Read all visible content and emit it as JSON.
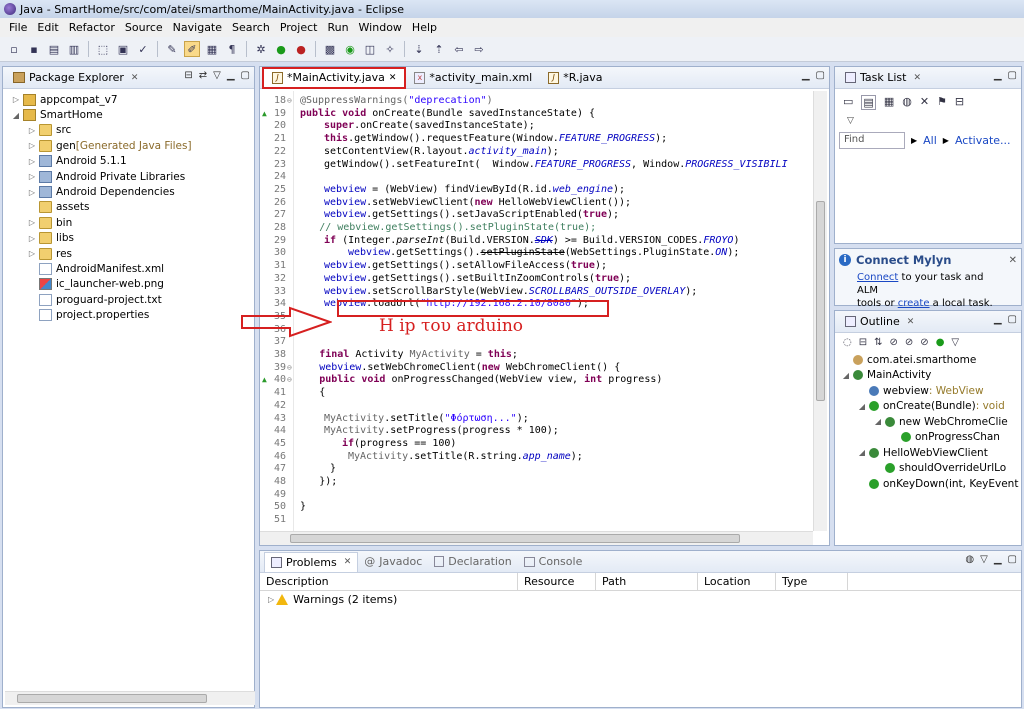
{
  "window": {
    "title": "Java - SmartHome/src/com/atei/smarthome/MainActivity.java - Eclipse"
  },
  "menu": [
    "File",
    "Edit",
    "Refactor",
    "Source",
    "Navigate",
    "Search",
    "Project",
    "Run",
    "Window",
    "Help"
  ],
  "package_explorer": {
    "title": "Package Explorer",
    "items": [
      {
        "label": "appcompat_v7",
        "twisty": "▷",
        "indent": 0,
        "icon": "project-icon"
      },
      {
        "label": "SmartHome",
        "twisty": "◢",
        "indent": 0,
        "icon": "project-icon"
      },
      {
        "label": "src",
        "twisty": "▷",
        "indent": 1,
        "icon": "folder-icon"
      },
      {
        "label": "gen",
        "extra": "[Generated Java Files]",
        "twisty": "▷",
        "indent": 1,
        "icon": "folder-icon"
      },
      {
        "label": "Android 5.1.1",
        "twisty": "▷",
        "indent": 1,
        "icon": "library-icon"
      },
      {
        "label": "Android Private Libraries",
        "twisty": "▷",
        "indent": 1,
        "icon": "library-icon"
      },
      {
        "label": "Android Dependencies",
        "twisty": "▷",
        "indent": 1,
        "icon": "library-icon"
      },
      {
        "label": "assets",
        "twisty": "",
        "indent": 1,
        "icon": "folder-icon"
      },
      {
        "label": "bin",
        "twisty": "▷",
        "indent": 1,
        "icon": "folder-icon"
      },
      {
        "label": "libs",
        "twisty": "▷",
        "indent": 1,
        "icon": "folder-icon"
      },
      {
        "label": "res",
        "twisty": "▷",
        "indent": 1,
        "icon": "folder-icon"
      },
      {
        "label": "AndroidManifest.xml",
        "twisty": "",
        "indent": 1,
        "icon": "file-icon"
      },
      {
        "label": "ic_launcher-web.png",
        "twisty": "",
        "indent": 1,
        "icon": "image-icon"
      },
      {
        "label": "proguard-project.txt",
        "twisty": "",
        "indent": 1,
        "icon": "file-icon"
      },
      {
        "label": "project.properties",
        "twisty": "",
        "indent": 1,
        "icon": "file-icon"
      }
    ]
  },
  "editor": {
    "tabs": [
      {
        "label": "*MainActivity.java",
        "active": true,
        "icon": "java-icon"
      },
      {
        "label": "*activity_main.xml",
        "active": false,
        "icon": "xml-icon"
      },
      {
        "label": "*R.java",
        "active": false,
        "icon": "java-icon"
      }
    ],
    "lines": [
      {
        "n": "18",
        "fold": "⊖",
        "html": "<span class='ann'>@SuppressWarnings(</span><span class='str'>\"deprecation\"</span><span class='ann'>)</span>",
        "indent": 0
      },
      {
        "n": "19",
        "marker": "▲",
        "html": "<span class='kw'>public void</span> onCreate(Bundle savedInstanceState) {",
        "indent": 0
      },
      {
        "n": "20",
        "html": "<span class='kw'>super</span>.onCreate(savedInstanceState);",
        "indent": 2
      },
      {
        "n": "21",
        "html": "<span class='kw'>this</span>.getWindow().requestFeature(Window.<span class='sfld'>FEATURE_PROGRESS</span>);",
        "indent": 2
      },
      {
        "n": "22",
        "html": "setContentView(R.layout.<span class='sfld'>activity_main</span>);",
        "indent": 2
      },
      {
        "n": "23",
        "html": "getWindow().setFeatureInt(  Window.<span class='sfld'>FEATURE_PROGRESS</span>, Window.<span class='sfld'>PROGRESS_VISIBILI</span>",
        "indent": 2
      },
      {
        "n": "24",
        "html": "",
        "indent": 0
      },
      {
        "n": "25",
        "html": "<span class='fld'>webview</span> = (WebView) findViewById(R.id.<span class='sfld'>web_engine</span>);",
        "indent": 2
      },
      {
        "n": "26",
        "html": "<span class='fld'>webview</span>.setWebViewClient(<span class='kw'>new</span> HelloWebViewClient());",
        "indent": 2
      },
      {
        "n": "27",
        "html": "<span class='fld'>webview</span>.getSettings().setJavaScriptEnabled(<span class='kw'>true</span>);",
        "indent": 2
      },
      {
        "n": "28",
        "html": "<span class='cmt'>// webview.getSettings().setPluginState(true);</span>",
        "indent": 1.6
      },
      {
        "n": "29",
        "html": "<span class='kw'>if</span> (Integer.<span class='smeth'>parseInt</span>(Build.VERSION.<span class='sfld strike'>SDK</span>) &gt;= Build.VERSION_CODES.<span class='sfld'>FROYO</span>)",
        "indent": 2
      },
      {
        "n": "30",
        "html": "<span class='fld'>webview</span>.getSettings().<span class='strike'>setPluginState</span>(WebSettings.PluginState.<span class='sfld'>ON</span>);",
        "indent": 4
      },
      {
        "n": "31",
        "html": "<span class='fld'>webview</span>.getSettings().setAllowFileAccess(<span class='kw'>true</span>);",
        "indent": 2
      },
      {
        "n": "32",
        "html": "<span class='fld'>webview</span>.getSettings().setBuiltInZoomControls(<span class='kw'>true</span>);",
        "indent": 2
      },
      {
        "n": "33",
        "html": "<span class='fld'>webview</span>.setScrollBarStyle(WebView.<span class='sfld'>SCROLLBARS_OUTSIDE_OVERLAY</span>);",
        "indent": 2
      },
      {
        "n": "34",
        "html": "<span class='fld'>webview</span>.loadUrl(<span class='str'>\"http://192.168.2.10/8080\"</span>);",
        "indent": 2
      },
      {
        "n": "35",
        "html": "",
        "indent": 0
      },
      {
        "n": "36",
        "html": "",
        "indent": 0
      },
      {
        "n": "37",
        "html": "",
        "indent": 0
      },
      {
        "n": "38",
        "html": "<span class='kw'>final</span> Activity <span class='ann'>MyActivity</span> = <span class='kw'>this</span>;",
        "indent": 1.6
      },
      {
        "n": "39",
        "fold": "⊖",
        "html": "<span class='fld'>webview</span>.setWebChromeClient(<span class='kw'>new</span> WebChromeClient() {",
        "indent": 1.6
      },
      {
        "n": "40",
        "marker": "▲",
        "fold": "⊖",
        "html": "<span class='kw'>public void</span> onProgressChanged(WebView view, <span class='kw'>int</span> progress)",
        "indent": 1.6
      },
      {
        "n": "41",
        "html": "{",
        "indent": 1.6
      },
      {
        "n": "42",
        "html": "",
        "indent": 0
      },
      {
        "n": "43",
        "html": "<span class='ann'>MyActivity</span>.setTitle(<span class='str'>\"Φόρτωση...\"</span>);",
        "indent": 2
      },
      {
        "n": "44",
        "html": "<span class='ann'>MyActivity</span>.setProgress(progress * 100);",
        "indent": 2
      },
      {
        "n": "45",
        "html": "<span class='kw'>if</span>(progress == 100)",
        "indent": 3.5
      },
      {
        "n": "46",
        "html": "<span class='ann'>MyActivity</span>.setTitle(R.string.<span class='sfld'>app_name</span>);",
        "indent": 4
      },
      {
        "n": "47",
        "html": "}",
        "indent": 2.5
      },
      {
        "n": "48",
        "html": "});",
        "indent": 1.6
      },
      {
        "n": "49",
        "html": "",
        "indent": 0
      },
      {
        "n": "50",
        "html": "}",
        "indent": 0
      },
      {
        "n": "51",
        "html": "",
        "indent": 0
      }
    ]
  },
  "annotation": {
    "text": "Η ip του arduino"
  },
  "task_list": {
    "title": "Task List",
    "find_placeholder": "Find",
    "all_label": "All",
    "activate_label": "Activate..."
  },
  "mylyn": {
    "title": "Connect Mylyn",
    "connect_link": "Connect",
    "text1": " to your task and ALM",
    "text2": "tools or ",
    "create_link": "create",
    "text3": " a local task."
  },
  "outline": {
    "title": "Outline",
    "items": [
      {
        "label": "com.atei.smarthome",
        "indent": 0,
        "twisty": ""
      },
      {
        "label": "MainActivity",
        "indent": 0,
        "twisty": "◢"
      },
      {
        "label": "webview",
        "type": " : WebView",
        "indent": 1,
        "twisty": ""
      },
      {
        "label": "onCreate(Bundle)",
        "type": " : void",
        "indent": 1,
        "twisty": "◢"
      },
      {
        "label": "new WebChromeClie",
        "indent": 2,
        "twisty": "◢"
      },
      {
        "label": "onProgressChan",
        "indent": 3,
        "twisty": ""
      },
      {
        "label": "HelloWebViewClient",
        "indent": 1,
        "twisty": "◢"
      },
      {
        "label": "shouldOverrideUrlLo",
        "indent": 2,
        "twisty": ""
      },
      {
        "label": "onKeyDown(int, KeyEvent",
        "indent": 1,
        "twisty": ""
      }
    ]
  },
  "bottom": {
    "tabs": [
      "Problems",
      "Javadoc",
      "Declaration",
      "Console"
    ],
    "columns": [
      "Description",
      "Resource",
      "Path",
      "Location",
      "Type"
    ],
    "rows": [
      {
        "description": "Warnings (2 items)"
      }
    ]
  }
}
